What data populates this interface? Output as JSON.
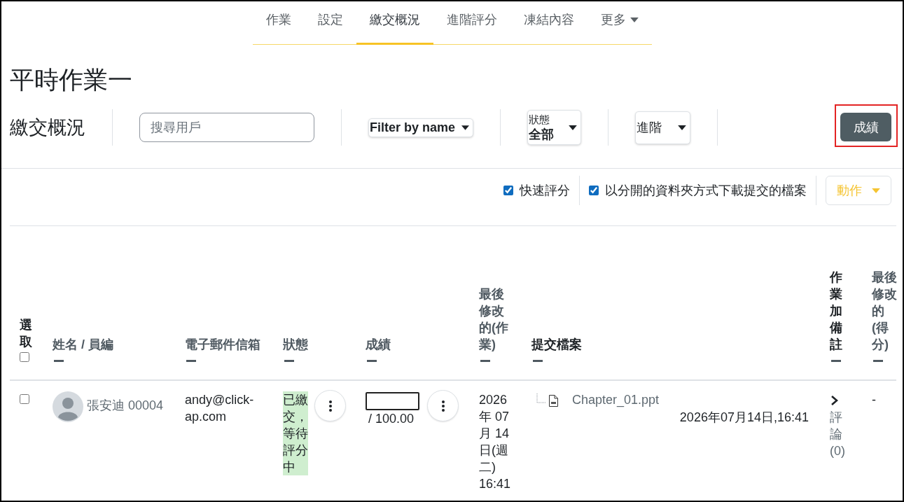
{
  "nav_tabs": [
    {
      "label": "作業",
      "selected": false,
      "kind": "link"
    },
    {
      "label": "設定",
      "selected": false,
      "kind": "link"
    },
    {
      "label": "繳交概況",
      "selected": true,
      "kind": "link"
    },
    {
      "label": "進階評分",
      "selected": false,
      "kind": "link"
    },
    {
      "label": "凍結內容",
      "selected": false,
      "kind": "link"
    },
    {
      "label": "更多",
      "selected": false,
      "kind": "menu"
    }
  ],
  "page_title": "平時作業一",
  "toolbar": {
    "heading": "繳交概況",
    "search": {
      "placeholder": "搜尋用戶"
    },
    "name_filter": {
      "value": "Filter by name"
    },
    "status_filter": {
      "label": "狀態",
      "value": "全部"
    },
    "advanced_filter": {
      "value": "進階"
    },
    "grade_button": {
      "label": "成績",
      "highlighted": true
    }
  },
  "options": [
    {
      "label": "快速評分",
      "checked": true
    },
    {
      "label": "以分開的資料夾方式下載提交的檔案",
      "checked": true
    }
  ],
  "actions_button": {
    "label": "動作"
  },
  "table": {
    "columns": [
      {
        "kind": "select",
        "label": "選取",
        "checked": false
      },
      {
        "kind": "sortable",
        "label": "姓名 / 員編"
      },
      {
        "kind": "sortable",
        "label": "電子郵件信箱"
      },
      {
        "kind": "sortable",
        "label": "狀態"
      },
      {
        "kind": "sortable",
        "label": "成績"
      },
      {
        "kind": "sortable",
        "label": "最後修改的(作業)"
      },
      {
        "kind": "plain",
        "label": "提交檔案"
      },
      {
        "kind": "plain",
        "label": "作業加備註"
      },
      {
        "kind": "sortable",
        "label": "最後修改的(得分)"
      }
    ],
    "rows": [
      {
        "selected": false,
        "name": "張安迪 00004",
        "email": "andy@click-ap.com",
        "status": {
          "text": "已繳交，等待評分中",
          "kind": "submitted"
        },
        "grade": {
          "max": "/ 100.00"
        },
        "last_modified": "2026年 07月 14日(週二) 16:41",
        "files": [
          {
            "name": "Chapter_01.ppt",
            "modified": "2026年07月14日,16:41"
          }
        ],
        "comments": {
          "label": "評論 (0)",
          "expanded": false
        },
        "grade_modified": "-"
      }
    ]
  }
}
